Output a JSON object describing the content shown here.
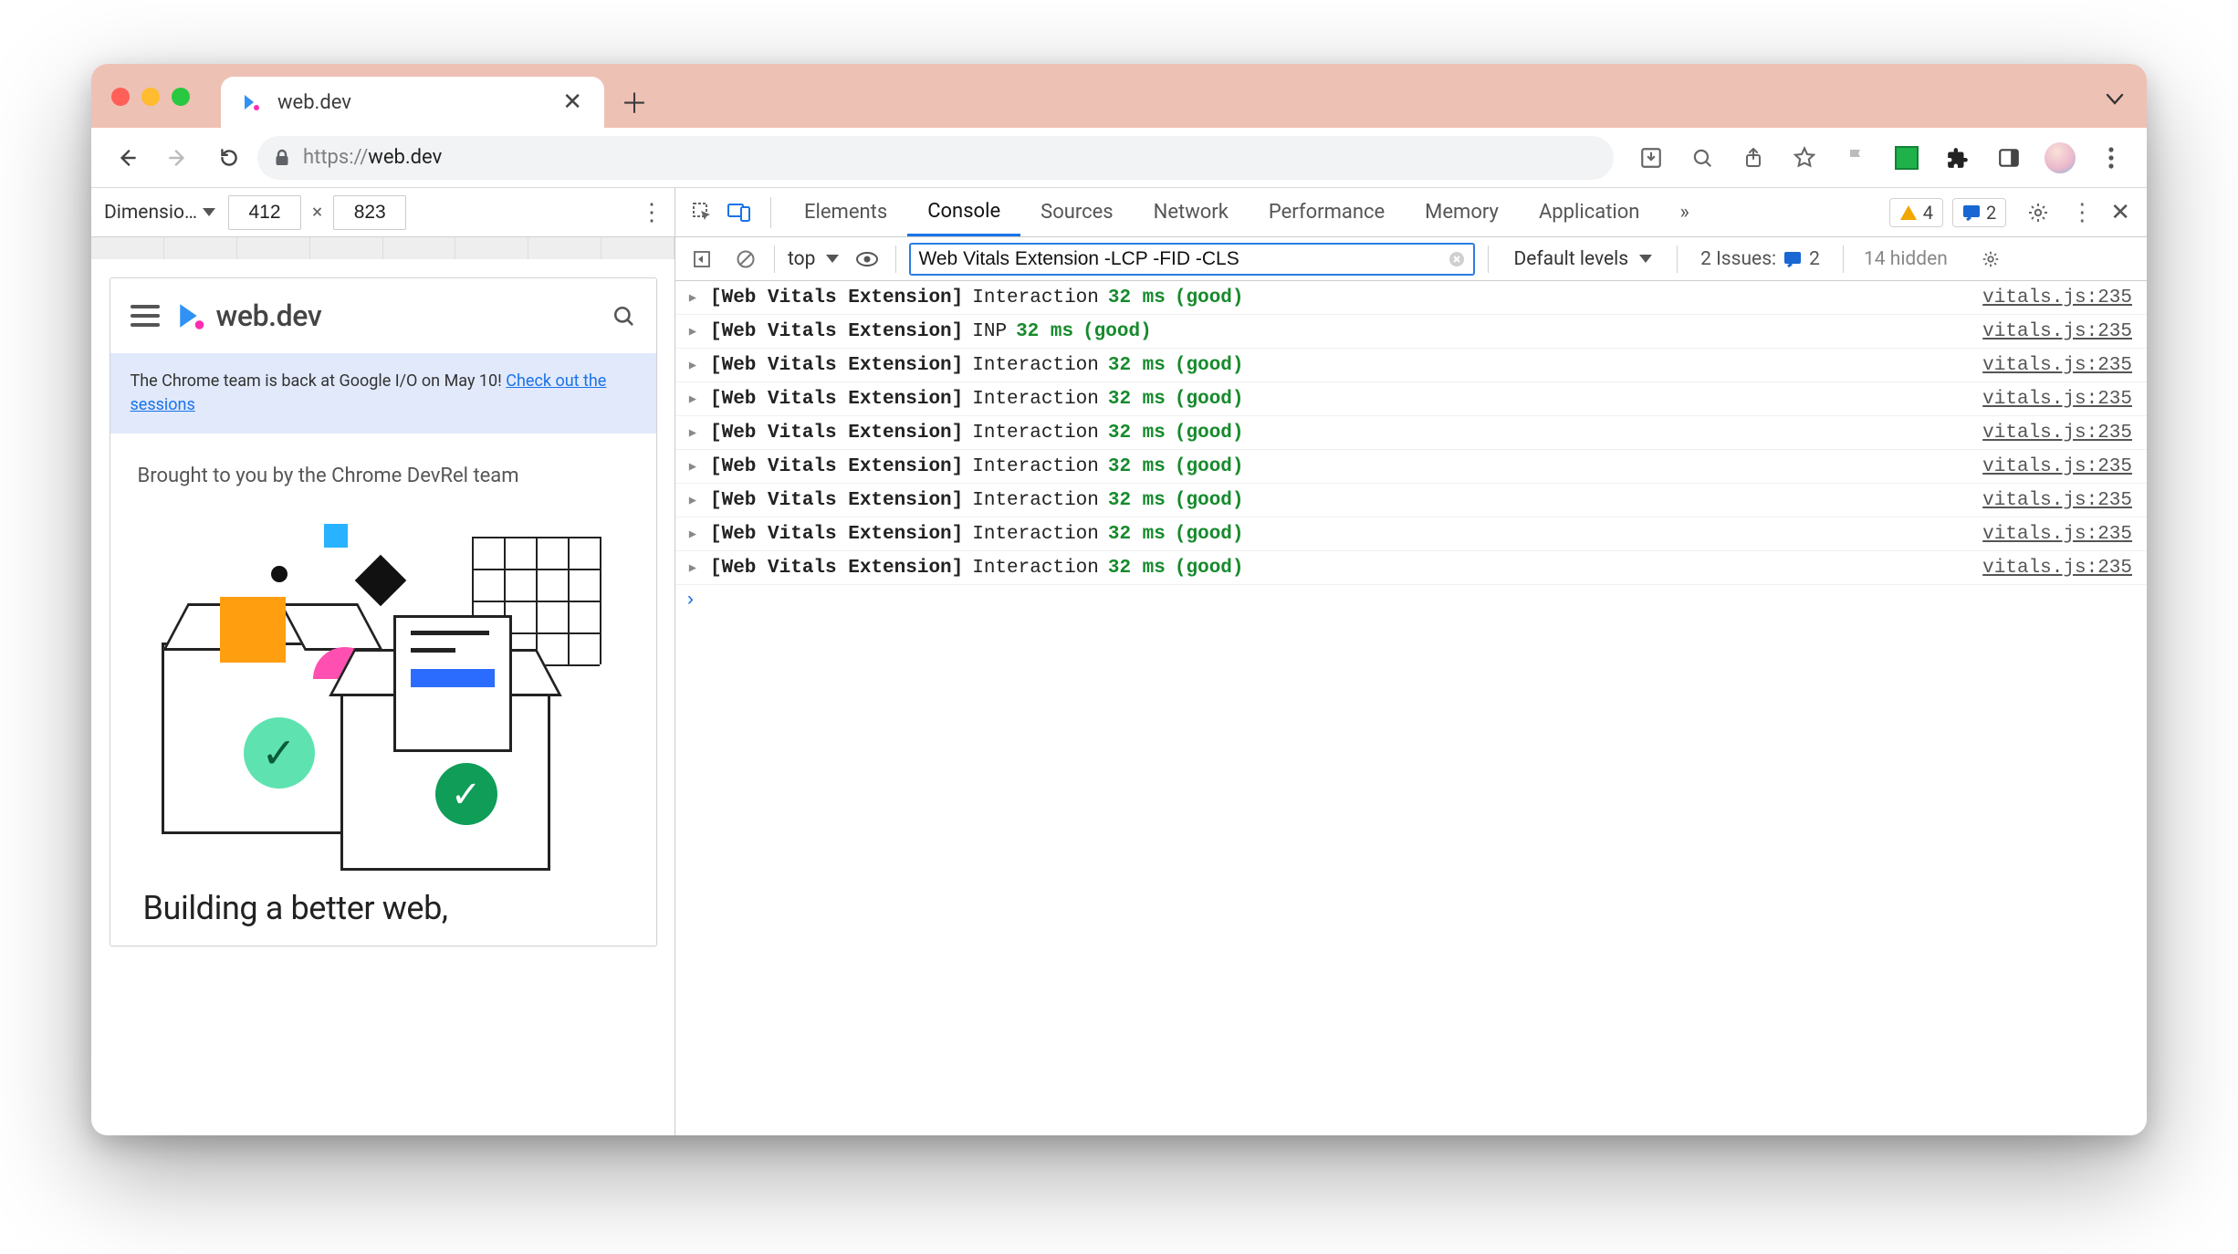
{
  "browser": {
    "tab_title": "web.dev",
    "url_scheme": "https://",
    "url_host": "web.dev"
  },
  "device_toolbar": {
    "dimensions_label": "Dimensio…",
    "width": "412",
    "height": "823",
    "separator": "×"
  },
  "page": {
    "site_title": "web.dev",
    "banner_text": "The Chrome team is back at Google I/O on May 10! ",
    "banner_link": "Check out the sessions",
    "intro": "Brought to you by the Chrome DevRel team",
    "headline": "Building a better web,"
  },
  "devtools": {
    "tabs": [
      "Elements",
      "Console",
      "Sources",
      "Network",
      "Performance",
      "Memory",
      "Application"
    ],
    "active_tab": "Console",
    "overflow": "»",
    "warning_count": "4",
    "message_count": "2",
    "filter_value": "Web Vitals Extension -LCP -FID -CLS",
    "context": "top",
    "levels_label": "Default levels",
    "issues_label": "2 Issues:",
    "issues_count": "2",
    "hidden_label": "14 hidden",
    "logs": [
      {
        "tag": "[Web Vitals Extension]",
        "metric": "Interaction",
        "value": "32 ms",
        "rating": "(good)",
        "source": "vitals.js:235"
      },
      {
        "tag": "[Web Vitals Extension]",
        "metric": "INP",
        "value": "32 ms",
        "rating": "(good)",
        "source": "vitals.js:235"
      },
      {
        "tag": "[Web Vitals Extension]",
        "metric": "Interaction",
        "value": "32 ms",
        "rating": "(good)",
        "source": "vitals.js:235"
      },
      {
        "tag": "[Web Vitals Extension]",
        "metric": "Interaction",
        "value": "32 ms",
        "rating": "(good)",
        "source": "vitals.js:235"
      },
      {
        "tag": "[Web Vitals Extension]",
        "metric": "Interaction",
        "value": "32 ms",
        "rating": "(good)",
        "source": "vitals.js:235"
      },
      {
        "tag": "[Web Vitals Extension]",
        "metric": "Interaction",
        "value": "32 ms",
        "rating": "(good)",
        "source": "vitals.js:235"
      },
      {
        "tag": "[Web Vitals Extension]",
        "metric": "Interaction",
        "value": "32 ms",
        "rating": "(good)",
        "source": "vitals.js:235"
      },
      {
        "tag": "[Web Vitals Extension]",
        "metric": "Interaction",
        "value": "32 ms",
        "rating": "(good)",
        "source": "vitals.js:235"
      },
      {
        "tag": "[Web Vitals Extension]",
        "metric": "Interaction",
        "value": "32 ms",
        "rating": "(good)",
        "source": "vitals.js:235"
      }
    ]
  }
}
